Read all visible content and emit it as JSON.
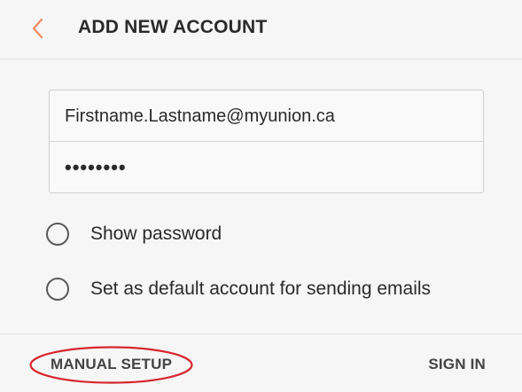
{
  "header": {
    "back_icon": "chevron-left-icon",
    "title": "ADD NEW ACCOUNT",
    "accent_color": "#f08a5d"
  },
  "form": {
    "email_value": "Firstname.Lastname@myunion.ca",
    "password_value": "••••••••"
  },
  "options": {
    "show_password_label": "Show password",
    "show_password_checked": false,
    "default_account_label": "Set as default account for sending emails",
    "default_account_checked": false
  },
  "footer": {
    "manual_setup_label": "MANUAL SETUP",
    "sign_in_label": "SIGN IN",
    "highlight_color": "#d7262e"
  }
}
